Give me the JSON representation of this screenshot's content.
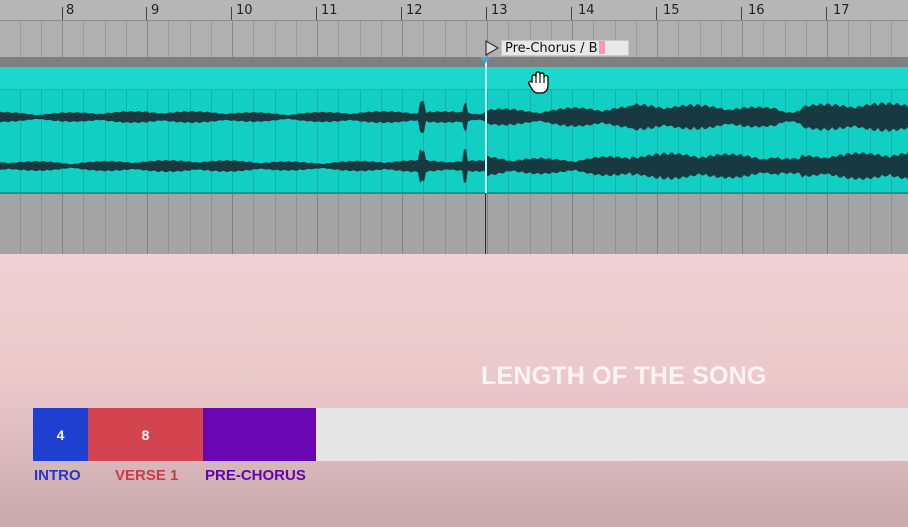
{
  "ruler": {
    "bars": [
      "8",
      "9",
      "10",
      "11",
      "12",
      "13",
      "14",
      "15",
      "16",
      "17"
    ]
  },
  "locator": {
    "name": "Pre-Chorus / B",
    "icon": "play-triangle-icon"
  },
  "cursor": {
    "icon": "hand-grab-cursor-icon"
  },
  "colors": {
    "clip": "#12cfc4",
    "waveform": "#17393f",
    "intro": "#1f3fd0",
    "verse": "#d3444e",
    "prechorus": "#6a07b3"
  },
  "overlay": {
    "title": "LENGTH OF THE SONG",
    "segments": [
      {
        "label": "INTRO",
        "value": "4",
        "bars": 4
      },
      {
        "label": "VERSE 1",
        "value": "8",
        "bars": 8
      },
      {
        "label": "PRE-CHORUS",
        "value": "",
        "bars": 8
      }
    ]
  }
}
